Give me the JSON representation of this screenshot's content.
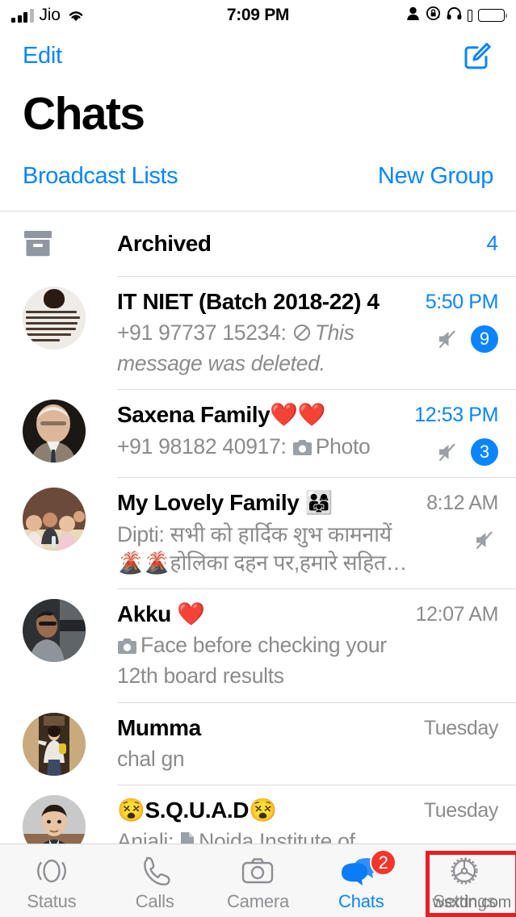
{
  "statusbar": {
    "carrier": "Jio",
    "time": "7:09 PM",
    "icons": [
      "signal-bars-icon",
      "wifi-icon",
      "person-icon",
      "rotation-lock-icon",
      "headphones-icon",
      "battery-icon"
    ]
  },
  "navbar": {
    "edit_label": "Edit",
    "compose_icon": "compose-icon"
  },
  "header": {
    "title": "Chats",
    "broadcast_label": "Broadcast Lists",
    "new_group_label": "New Group"
  },
  "archived": {
    "label": "Archived",
    "count": "4",
    "icon": "archive-box-icon"
  },
  "chats": [
    {
      "name": "IT NIET (Batch 2018-22) 4",
      "sender": "+91 97737 15234:",
      "snippet": "This message was deleted.",
      "snippet_icon": "blocked-icon",
      "italic": true,
      "time": "5:50 PM",
      "time_color": "blue",
      "muted": true,
      "badge": "9",
      "avatar": "quote-image"
    },
    {
      "name": "Saxena Family❤️❤️",
      "sender": "+91 98182 40917:",
      "snippet": "Photo",
      "snippet_icon": "camera-icon",
      "italic": false,
      "time": "12:53 PM",
      "time_color": "blue",
      "muted": true,
      "badge": "3",
      "avatar": "elderly-man-photo"
    },
    {
      "name": "My Lovely Family 👨‍👩‍👧",
      "sender": "Dipti:",
      "snippet": "सभी को हार्दिक शुभ कामनायें 🌋🌋होलिका दहन पर,हमारे सहित  सबके मन से ईर्ष्या, द्वेष, राग, मद...",
      "snippet_icon": "",
      "italic": false,
      "time": "8:12 AM",
      "time_color": "gray",
      "muted": true,
      "badge": "",
      "avatar": "family-group-photo"
    },
    {
      "name": "Akku ❤️",
      "sender": "",
      "snippet": "Face before checking your 12th board results",
      "snippet_icon": "camera-icon",
      "italic": false,
      "time": "12:07 AM",
      "time_color": "gray",
      "muted": false,
      "badge": "",
      "avatar": "man-sunglasses-photo"
    },
    {
      "name": "Mumma",
      "sender": "",
      "snippet": "chal gn",
      "snippet_icon": "",
      "italic": false,
      "time": "Tuesday",
      "time_color": "gray",
      "muted": false,
      "badge": "",
      "avatar": "woman-doorway-photo"
    },
    {
      "name": "😵S.Q.U.A.D😵",
      "sender": "Anjali:",
      "snippet": "Noida Institute of Engineering Technology, GR. NOIDA (An Autonomous...",
      "snippet_icon": "document-icon",
      "italic": false,
      "time": "Tuesday",
      "time_color": "gray",
      "muted": false,
      "badge": "",
      "avatar": "boy-portrait-photo"
    }
  ],
  "tabbar": {
    "tabs": [
      {
        "label": "Status",
        "icon": "status-rings-icon",
        "active": false,
        "badge": ""
      },
      {
        "label": "Calls",
        "icon": "phone-icon",
        "active": false,
        "badge": ""
      },
      {
        "label": "Camera",
        "icon": "camera-icon",
        "active": false,
        "badge": ""
      },
      {
        "label": "Chats",
        "icon": "chat-bubbles-icon",
        "active": true,
        "badge": "2"
      },
      {
        "label": "Settings",
        "icon": "gear-icon",
        "active": false,
        "badge": ""
      }
    ],
    "highlighted_tab": "Settings",
    "highlight_color": "#e81e23"
  },
  "watermark": "wsxdn.com",
  "colors": {
    "accent_blue": "#0a84ff",
    "badge_blue": "#0a84ff",
    "badge_red": "#f5342b",
    "muted_gray": "#8b8b8b",
    "tab_gray": "#8e8e93"
  }
}
